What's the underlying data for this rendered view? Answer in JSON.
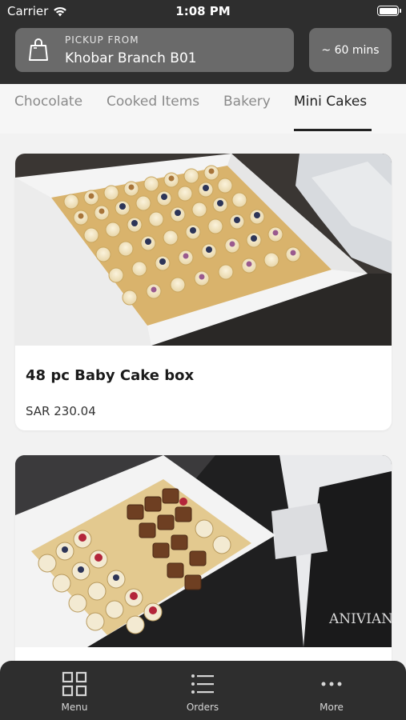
{
  "status_bar": {
    "carrier": "Carrier",
    "time": "1:08 PM"
  },
  "header": {
    "pickup_label": "PICKUP FROM",
    "branch": "Khobar Branch B01",
    "eta": "~ 60 mins"
  },
  "tabs": [
    {
      "label": "Chocolate",
      "active": false
    },
    {
      "label": "Cooked Items",
      "active": false
    },
    {
      "label": "Bakery",
      "active": false
    },
    {
      "label": "Mini Cakes",
      "active": true
    }
  ],
  "products": [
    {
      "title": "48 pc Baby Cake box",
      "price": "SAR 230.04",
      "image": "cupcakes-box-photo"
    },
    {
      "title": "",
      "price": "",
      "image": "mixed-cupcakes-box-photo"
    }
  ],
  "bottom_nav": [
    {
      "label": "Menu",
      "icon": "grid-icon"
    },
    {
      "label": "Orders",
      "icon": "list-icon"
    },
    {
      "label": "More",
      "icon": "more-dots-icon"
    }
  ],
  "colors": {
    "header_bg": "#2e2e2e",
    "pill_bg": "#6a6a6a",
    "page_bg": "#f2f2f2"
  }
}
